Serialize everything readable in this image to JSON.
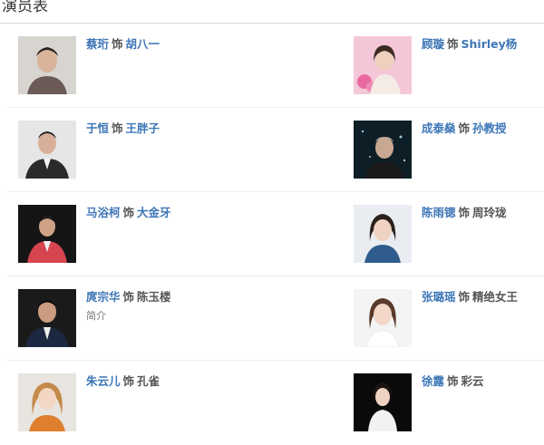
{
  "section_title": "演员表",
  "connector": "饰",
  "cast": [
    {
      "actor": "蔡珩",
      "role": "胡八一",
      "role_linked": true,
      "photo_icon": "actor-photo"
    },
    {
      "actor": "顾璇",
      "role": "Shirley杨",
      "role_linked": true,
      "photo_icon": "actress-photo"
    },
    {
      "actor": "于恒",
      "role": "王胖子",
      "role_linked": true,
      "photo_icon": "actor-photo"
    },
    {
      "actor": "成泰燊",
      "role": "孙教授",
      "role_linked": true,
      "photo_icon": "actor-photo"
    },
    {
      "actor": "马浴柯",
      "role": "大金牙",
      "role_linked": true,
      "photo_icon": "actor-photo"
    },
    {
      "actor": "陈雨锶",
      "role": "周玲珑",
      "role_linked": false,
      "photo_icon": "actress-photo"
    },
    {
      "actor": "庹宗华",
      "role": "陈玉楼",
      "role_linked": false,
      "intro": "简介",
      "photo_icon": "actor-photo"
    },
    {
      "actor": "张璐瑶",
      "role": "精绝女王",
      "role_linked": false,
      "photo_icon": "actress-photo"
    },
    {
      "actor": "朱云儿",
      "role": "孔雀",
      "role_linked": false,
      "photo_icon": "actress-photo"
    },
    {
      "actor": "徐露",
      "role": "彩云",
      "role_linked": false,
      "photo_icon": "actress-photo"
    }
  ],
  "colors": {
    "link": "#3d76b7",
    "text": "#555555"
  }
}
